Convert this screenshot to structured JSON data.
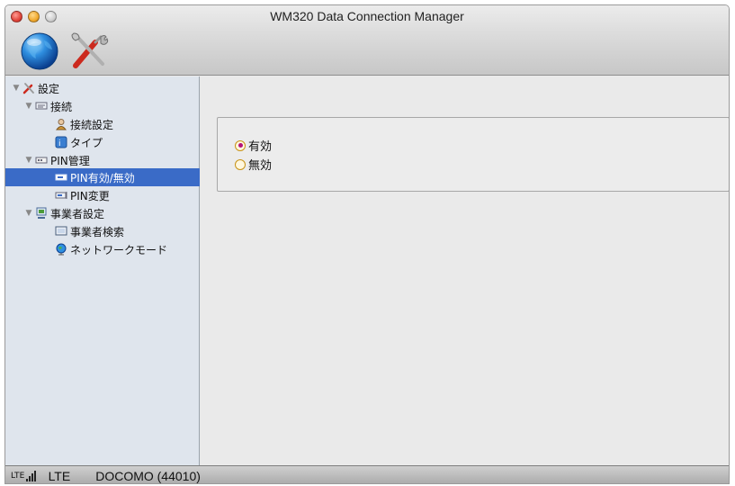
{
  "window": {
    "title": "WM320 Data Connection Manager"
  },
  "toolbar": {
    "globe_icon": "globe-icon",
    "settings_icon": "tools-icon"
  },
  "tree": {
    "items": [
      {
        "label": "設定",
        "icon": "tools-icon",
        "level": 0,
        "expanded": true
      },
      {
        "label": "接続",
        "icon": "network-icon",
        "level": 1,
        "expanded": true
      },
      {
        "label": "接続設定",
        "icon": "user-icon",
        "level": 2
      },
      {
        "label": "タイプ",
        "icon": "type-icon",
        "level": 2
      },
      {
        "label": "PIN管理",
        "icon": "pin-icon",
        "level": 1,
        "expanded": true
      },
      {
        "label": "PIN有効/無効",
        "icon": "pin-toggle-icon",
        "level": 2,
        "selected": true
      },
      {
        "label": "PIN変更",
        "icon": "pin-change-icon",
        "level": 2
      },
      {
        "label": "事業者設定",
        "icon": "carrier-icon",
        "level": 1,
        "expanded": true
      },
      {
        "label": "事業者検索",
        "icon": "monitor-icon",
        "level": 2
      },
      {
        "label": "ネットワークモード",
        "icon": "globe-icon",
        "level": 2
      }
    ]
  },
  "pin_setting": {
    "options": [
      {
        "label": "有効",
        "checked": true
      },
      {
        "label": "無効",
        "checked": false
      }
    ]
  },
  "status": {
    "network_small": "LTE",
    "network": "LTE",
    "carrier": "DOCOMO (44010)",
    "signal_level": 4
  },
  "colors": {
    "selection": "#3a6bc7",
    "sidebar_bg": "#dfe5ed",
    "radio_dot": "#b5127a"
  }
}
